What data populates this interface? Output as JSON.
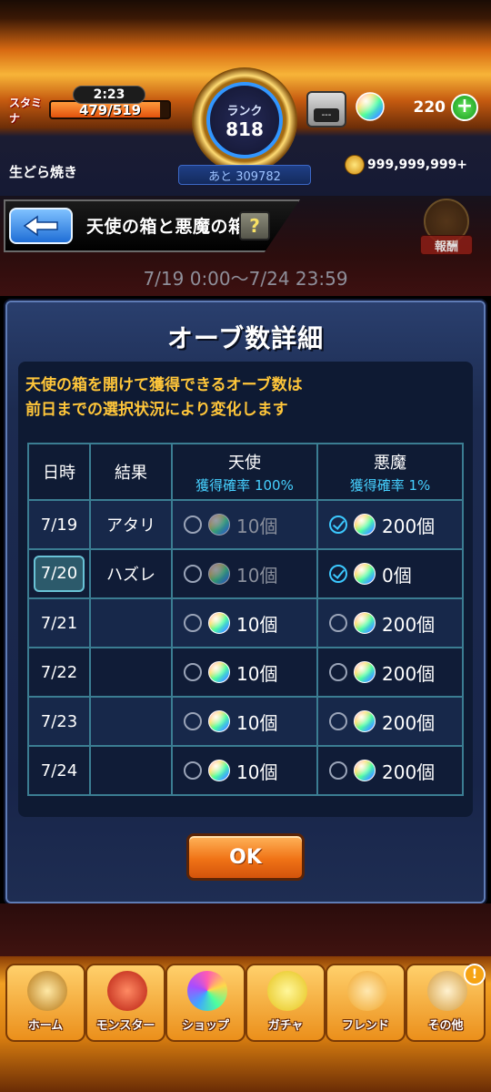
{
  "status": {
    "stamina_label": "スタミナ",
    "stamina_timer": "2:23",
    "stamina_value": "479/519",
    "stamina_fraction": 0.923,
    "rank_label": "ランク",
    "rank_value": "818",
    "next_exp": "あと 309782",
    "badge_text": "---",
    "orb_count": "220",
    "plus_symbol": "+",
    "username": "生どら焼き",
    "coins": "999,999,999+"
  },
  "header": {
    "title": "天使の箱と悪魔の箱",
    "help_symbol": "?",
    "reward_label": "報酬",
    "period": "7/19 0:00〜7/24 23:59"
  },
  "modal": {
    "title": "オーブ数詳細",
    "desc_line1": "天使の箱を開けて獲得できるオーブ数は",
    "desc_line2": "前日までの選択状況により変化します",
    "headers": {
      "date": "日時",
      "result": "結果",
      "angel": "天使",
      "angel_rate": "獲得確率 100%",
      "devil": "悪魔",
      "devil_rate": "獲得確率 1%"
    },
    "rows": [
      {
        "date": "7/19",
        "result": "アタリ",
        "angel": "10個",
        "devil": "200個"
      },
      {
        "date": "7/20",
        "result": "ハズレ",
        "angel": "10個",
        "devil": "0個"
      },
      {
        "date": "7/21",
        "result": "",
        "angel": "10個",
        "devil": "200個"
      },
      {
        "date": "7/22",
        "result": "",
        "angel": "10個",
        "devil": "200個"
      },
      {
        "date": "7/23",
        "result": "",
        "angel": "10個",
        "devil": "200個"
      },
      {
        "date": "7/24",
        "result": "",
        "angel": "10個",
        "devil": "200個"
      }
    ],
    "ok_label": "OK"
  },
  "nav": {
    "items": [
      {
        "label": "ホーム",
        "icon": "home-gate-icon"
      },
      {
        "label": "モンスター",
        "icon": "monster-icon"
      },
      {
        "label": "ショップ",
        "icon": "orb-icon"
      },
      {
        "label": "ガチャ",
        "icon": "gacha-egg-icon"
      },
      {
        "label": "フレンド",
        "icon": "friends-icon"
      },
      {
        "label": "その他",
        "icon": "other-icon"
      }
    ],
    "alert_symbol": "!"
  },
  "colors": {
    "accent_cyan": "#46d0ff",
    "desc_yellow": "#ffc63a",
    "ok_orange": "#f07316",
    "table_border": "#3b7d92"
  }
}
